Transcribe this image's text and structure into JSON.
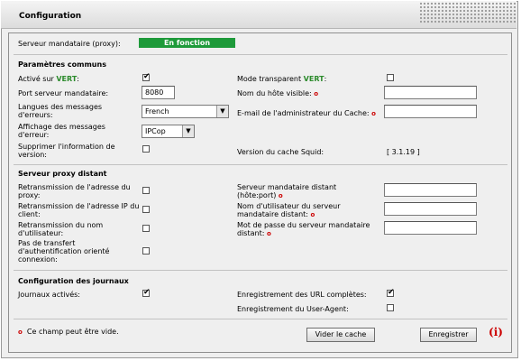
{
  "window": {
    "title": "Configuration"
  },
  "proxy": {
    "label": "Serveur mandataire (proxy):",
    "status": "En fonction",
    "status_color": "#1e9a3a"
  },
  "common": {
    "heading": "Paramètres communs",
    "active_green_label_pre": "Activé sur ",
    "active_green_label_green": "VERT",
    "active_green_label_post": ":",
    "active_green_checked": true,
    "transparent_label_pre": "Mode transparent ",
    "transparent_label_green": "VERT",
    "transparent_label_post": ":",
    "transparent_checked": false,
    "port_label": "Port serveur mandataire:",
    "port_value": "8080",
    "hostname_label": "Nom du hôte visible:",
    "hostname_value": "",
    "lang_label": "Langues des messages d'erreurs:",
    "lang_value": "French",
    "admin_email_label": "E-mail de l'administrateur du Cache:",
    "admin_email_value": "",
    "error_display_label": "Affichage des messages d'erreur:",
    "error_display_value": "IPCop",
    "suppress_version_label": "Supprimer l'information de version:",
    "suppress_version_checked": false,
    "squid_version_label": "Version du cache Squid:",
    "squid_version_value": "[ 3.1.19 ]"
  },
  "remote": {
    "heading": "Serveur proxy distant",
    "forward_proxy_label": "Retransmission de l'adresse du proxy:",
    "forward_ip_label": "Retransmission de l'adresse IP du client:",
    "forward_user_label": "Retransmission du nom d'utilisateur:",
    "no_auth_label": "Pas de transfert d'authentification orienté connexion:",
    "remote_host_label": "Serveur mandataire distant (hôte:port)",
    "remote_user_label": "Nom d'utilisateur du serveur mandataire distant:",
    "remote_pass_label": "Mot de passe du serveur mandataire distant:"
  },
  "logs": {
    "heading": "Configuration des journaux",
    "enabled_label": "Journaux activés:",
    "enabled_checked": true,
    "url_label": "Enregistrement des URL complètes:",
    "url_checked": true,
    "ua_label": "Enregistrement du User-Agent:",
    "ua_checked": false
  },
  "footer": {
    "note": "Ce champ peut être vide.",
    "clear_cache": "Vider le cache",
    "save": "Enregistrer",
    "info_icon": "i",
    "required_marker": "o"
  }
}
